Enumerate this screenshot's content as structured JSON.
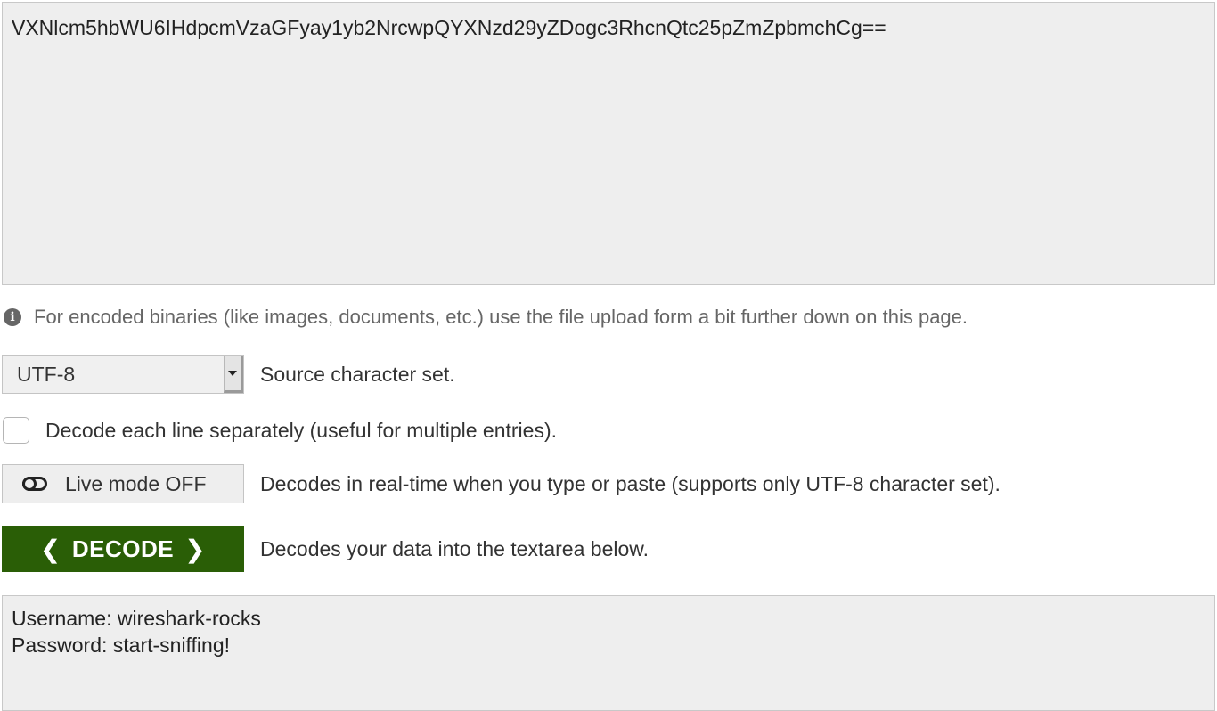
{
  "input": {
    "value": "VXNlcm5hbWU6IHdpcmVzaGFyay1yb2NrcwpQYXNzd29yZDogc3RhcnQtc25pZmZpbmchCg=="
  },
  "info": {
    "icon": "info-circle-icon",
    "text": "For encoded binaries (like images, documents, etc.) use the file upload form a bit further down on this page."
  },
  "charset": {
    "selected": "UTF-8",
    "label": "Source character set."
  },
  "line_by_line": {
    "checked": false,
    "label": "Decode each line separately (useful for multiple entries)."
  },
  "live_mode": {
    "icon": "toggle-off-icon",
    "button_label": "Live mode OFF",
    "description": "Decodes in real-time when you type or paste (supports only UTF-8 character set)."
  },
  "decode": {
    "left_chevron": "❮",
    "button_label": "DECODE",
    "right_chevron": "❯",
    "description": "Decodes your data into the textarea below.",
    "color": "#2a5e06"
  },
  "output": {
    "value": "Username: wireshark-rocks\nPassword: start-sniffing!"
  }
}
